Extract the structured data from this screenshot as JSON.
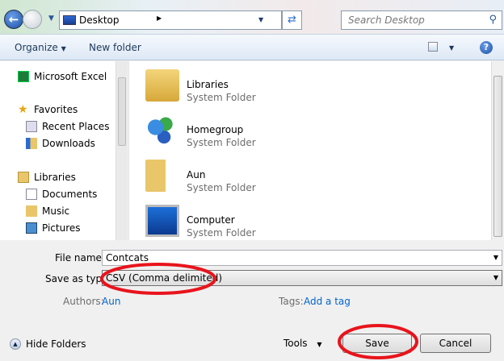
{
  "navigation": {
    "location": "Desktop",
    "search_placeholder": "Search Desktop"
  },
  "toolbar": {
    "organize": "Organize",
    "new_folder": "New folder"
  },
  "sidebar": {
    "items": [
      {
        "label": "Microsoft Excel",
        "icon": "excel-icon"
      },
      {
        "label": "Favorites",
        "icon": "star-icon"
      },
      {
        "label": "Recent Places",
        "icon": "recent-places-icon"
      },
      {
        "label": "Downloads",
        "icon": "downloads-icon"
      },
      {
        "label": "Libraries",
        "icon": "libraries-icon"
      },
      {
        "label": "Documents",
        "icon": "documents-icon"
      },
      {
        "label": "Music",
        "icon": "music-icon"
      },
      {
        "label": "Pictures",
        "icon": "pictures-icon"
      }
    ]
  },
  "files": [
    {
      "name": "Libraries",
      "type": "System Folder",
      "icon": "libraries-folder-icon"
    },
    {
      "name": "Homegroup",
      "type": "System Folder",
      "icon": "homegroup-icon"
    },
    {
      "name": "Aun",
      "type": "System Folder",
      "icon": "user-folder-icon"
    },
    {
      "name": "Computer",
      "type": "System Folder",
      "icon": "computer-icon"
    }
  ],
  "form": {
    "file_name_label": "File name:",
    "file_name": "Contcats",
    "save_type_label": "Save as type:",
    "save_type": "CSV (Comma delimited)",
    "authors_label": "Authors:",
    "authors": "Aun",
    "tags_label": "Tags:",
    "tags": "Add a tag"
  },
  "footer": {
    "hide_folders": "Hide Folders",
    "tools": "Tools",
    "save": "Save",
    "cancel": "Cancel"
  },
  "annotation_color": "#e8141c"
}
